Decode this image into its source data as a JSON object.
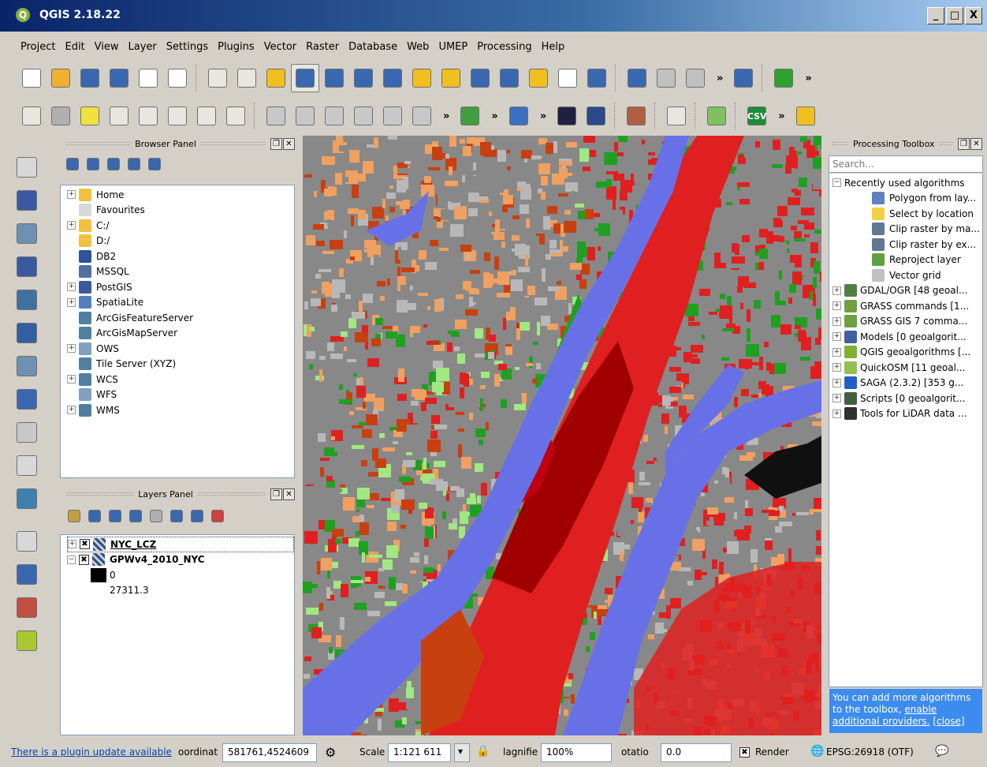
{
  "window": {
    "title": "QGIS 2.18.22",
    "icon": "qgis-logo-icon",
    "min": "_",
    "max": "□",
    "close": "X"
  },
  "menubar": [
    "Project",
    "Edit",
    "View",
    "Layer",
    "Settings",
    "Plugins",
    "Vector",
    "Raster",
    "Database",
    "Web",
    "UMEP",
    "Processing",
    "Help"
  ],
  "toolbar1": [
    {
      "name": "new-project-icon",
      "color": "#ffffff"
    },
    {
      "name": "open-project-icon",
      "color": "#f0b030"
    },
    {
      "name": "save-project-icon",
      "color": "#3a68b0"
    },
    {
      "name": "save-as-icon",
      "color": "#3a68b0"
    },
    {
      "name": "new-print-composer-icon",
      "color": "#ffffff"
    },
    {
      "name": "composer-manager-icon",
      "color": "#ffffff"
    },
    {
      "sep": true
    },
    {
      "name": "touch-zoom-icon",
      "color": "#e8e6e0"
    },
    {
      "name": "pan-icon",
      "color": "#e8e6e0"
    },
    {
      "name": "pan-to-selection-icon",
      "color": "#f0c020"
    },
    {
      "name": "zoom-in-icon",
      "color": "#3a68b0",
      "selected": true
    },
    {
      "name": "zoom-out-icon",
      "color": "#3a68b0"
    },
    {
      "name": "zoom-native-icon",
      "color": "#3a68b0"
    },
    {
      "name": "zoom-full-icon",
      "color": "#3a68b0"
    },
    {
      "name": "zoom-to-selection-icon",
      "color": "#f0c020"
    },
    {
      "name": "zoom-to-layer-icon",
      "color": "#f0c020"
    },
    {
      "name": "zoom-last-icon",
      "color": "#3a68b0"
    },
    {
      "name": "zoom-next-icon",
      "color": "#3a68b0"
    },
    {
      "name": "new-map-view-icon",
      "color": "#f0c020"
    },
    {
      "name": "new-bookmark-icon",
      "color": "#ffffff"
    },
    {
      "name": "refresh-icon",
      "color": "#3a68b0"
    },
    {
      "sep": true
    },
    {
      "name": "identify-icon",
      "color": "#3a68b0"
    },
    {
      "name": "action-icon",
      "color": "#c0c0c0"
    },
    {
      "name": "select-features-icon",
      "color": "#c0c0c0"
    },
    {
      "more": "»"
    },
    {
      "name": "help-icon",
      "color": "#3a68b0"
    },
    {
      "sep": true
    },
    {
      "name": "plugin-green-icon",
      "color": "#30a030"
    },
    {
      "more": "»"
    }
  ],
  "toolbar2": [
    {
      "name": "label-abc-icon",
      "color": "#e8e6e0"
    },
    {
      "name": "label-pin-icon",
      "color": "#b0b0b0"
    },
    {
      "name": "label-highlight-icon",
      "color": "#f0e040"
    },
    {
      "name": "label-move-icon",
      "color": "#e8e6e0"
    },
    {
      "name": "label-show-hide-icon",
      "color": "#e8e6e0"
    },
    {
      "name": "label-rotate-icon",
      "color": "#e8e6e0"
    },
    {
      "name": "label-change-icon",
      "color": "#e8e6e0"
    },
    {
      "name": "label-abc2-icon",
      "color": "#e8e6e0"
    },
    {
      "sep": true
    },
    {
      "name": "edit-pencil-icon",
      "color": "#c8c8c8"
    },
    {
      "name": "toggle-edit-icon",
      "color": "#c8c8c8"
    },
    {
      "name": "save-edits-icon",
      "color": "#c8c8c8"
    },
    {
      "name": "add-feature-icon",
      "color": "#c8c8c8"
    },
    {
      "name": "node-tool-icon",
      "color": "#c8c8c8"
    },
    {
      "name": "delete-selected-icon",
      "color": "#c8c8c8"
    },
    {
      "more": "»"
    },
    {
      "name": "histogram-icon",
      "color": "#40a040"
    },
    {
      "more": "»"
    },
    {
      "name": "python-icon",
      "color": "#3a70c0"
    },
    {
      "more": "»"
    },
    {
      "name": "layer-black-icon",
      "color": "#202040"
    },
    {
      "name": "diamond-icon",
      "color": "#2a4a8a"
    },
    {
      "sep": true
    },
    {
      "name": "terrain-icon",
      "color": "#b06040"
    },
    {
      "sep": true
    },
    {
      "name": "profile-icon",
      "color": "#e8e6e0"
    },
    {
      "sep": true
    },
    {
      "name": "map-grid-icon",
      "color": "#80c060"
    },
    {
      "sep": true
    },
    {
      "name": "csv-icon",
      "color": "#1e8c3a",
      "text": "CSV"
    },
    {
      "more": "»"
    },
    {
      "name": "plug-icon",
      "color": "#f0c020"
    }
  ],
  "browser": {
    "title": "Browser Panel",
    "tools": [
      {
        "name": "add-selected-icon",
        "color": "#3a68b0"
      },
      {
        "name": "refresh-icon",
        "color": "#3a68b0"
      },
      {
        "name": "filter-icon",
        "color": "#3a68b0"
      },
      {
        "name": "collapse-all-icon",
        "color": "#3a68b0"
      },
      {
        "name": "properties-icon",
        "color": "#3a68b0"
      }
    ],
    "items": [
      {
        "label": "Home",
        "icon": "folder-icon",
        "color": "#f0c040",
        "exp": true
      },
      {
        "label": "Favourites",
        "icon": "star-icon",
        "color": "#d8d8d8"
      },
      {
        "label": "C:/",
        "icon": "folder-icon",
        "color": "#f0c040",
        "exp": true
      },
      {
        "label": "D:/",
        "icon": "folder-icon",
        "color": "#f0c040"
      },
      {
        "label": "DB2",
        "icon": "db2-icon",
        "color": "#3050a0"
      },
      {
        "label": "MSSQL",
        "icon": "mssql-icon",
        "color": "#5070a0"
      },
      {
        "label": "PostGIS",
        "icon": "postgis-elephant-icon",
        "color": "#3a5aa0",
        "exp": true
      },
      {
        "label": "SpatiaLite",
        "icon": "spatialite-feather-icon",
        "color": "#5080c0",
        "exp": true
      },
      {
        "label": "ArcGisFeatureServer",
        "icon": "globe-icon",
        "color": "#5080a0"
      },
      {
        "label": "ArcGisMapServer",
        "icon": "globe-icon",
        "color": "#5080a0"
      },
      {
        "label": "OWS",
        "icon": "ows-globe-icon",
        "color": "#80a0c0",
        "exp": true
      },
      {
        "label": "Tile Server (XYZ)",
        "icon": "globe-icon",
        "color": "#5080a0"
      },
      {
        "label": "WCS",
        "icon": "wcs-globe-icon",
        "color": "#5080a0",
        "exp": true
      },
      {
        "label": "WFS",
        "icon": "wfs-globe-icon",
        "color": "#80a0c0"
      },
      {
        "label": "WMS",
        "icon": "wms-globe-icon",
        "color": "#5080a0",
        "exp": true
      }
    ]
  },
  "layers": {
    "title": "Layers Panel",
    "tools": [
      {
        "name": "styling-icon",
        "color": "#c0a040"
      },
      {
        "name": "add-group-icon",
        "color": "#3a68b0"
      },
      {
        "name": "visibility-icon",
        "color": "#3a68b0"
      },
      {
        "name": "filter-legend-icon",
        "color": "#3a68b0"
      },
      {
        "name": "filter-expression-icon",
        "color": "#b0b0b0"
      },
      {
        "name": "expand-all-icon",
        "color": "#3a68b0"
      },
      {
        "name": "collapse-all-icon",
        "color": "#3a68b0"
      },
      {
        "name": "remove-layer-icon",
        "color": "#d04040"
      }
    ],
    "items": [
      {
        "label": "NYC_LCZ",
        "checked": "✖",
        "exp": "+"
      },
      {
        "label": "GPWv4_2010_NYC",
        "checked": "✖",
        "exp": "−"
      }
    ],
    "legend": [
      "0",
      "27311.3"
    ]
  },
  "processing": {
    "title": "Processing Toolbox",
    "search_placeholder": "Search...",
    "recent": "Recently used algorithms",
    "recent_items": [
      {
        "label": "Polygon from lay...",
        "icon": "polygon-icon",
        "color": "#6080c0"
      },
      {
        "label": "Select by location",
        "icon": "select-location-icon",
        "color": "#f0d040"
      },
      {
        "label": "Clip raster by ma...",
        "icon": "raster-icon",
        "color": "#607890"
      },
      {
        "label": "Clip raster by ex...",
        "icon": "raster-icon",
        "color": "#607890"
      },
      {
        "label": "Reproject layer",
        "icon": "reproject-icon",
        "color": "#60a040"
      },
      {
        "label": "Vector grid",
        "icon": "grid-icon",
        "color": "#c0c0c0"
      }
    ],
    "providers": [
      {
        "label": "GDAL/OGR [48 geoal...",
        "icon": "gdal-icon",
        "color": "#508040"
      },
      {
        "label": "GRASS commands [1...",
        "icon": "grass-icon",
        "color": "#70a040"
      },
      {
        "label": "GRASS GIS 7 comma...",
        "icon": "grass-icon",
        "color": "#70a040"
      },
      {
        "label": "Models [0 geoalgorit...",
        "icon": "models-icon",
        "color": "#4060a0"
      },
      {
        "label": "QGIS geoalgorithms [...",
        "icon": "qgis-algo-icon",
        "color": "#80b030"
      },
      {
        "label": "QuickOSM [11 geoal...",
        "icon": "quickosm-icon",
        "color": "#90c050"
      },
      {
        "label": "SAGA (2.3.2) [353 g...",
        "icon": "saga-icon",
        "color": "#2060c0"
      },
      {
        "label": "Scripts [0 geoalgorit...",
        "icon": "scripts-icon",
        "color": "#406040"
      },
      {
        "label": "Tools for LiDAR data ...",
        "icon": "lidar-icon",
        "color": "#303030"
      }
    ],
    "info_text": "You can add more algorithms to the toolbox, ",
    "info_link": "enable additional providers.",
    "info_close": "[close]"
  },
  "left_tools": [
    {
      "name": "add-vector-layer-icon",
      "color": "#d8d8d8"
    },
    {
      "name": "add-raster-layer-icon",
      "color": "#3a5aa0"
    },
    {
      "name": "add-spatialite-layer-icon",
      "color": "#7090b0"
    },
    {
      "name": "add-postgis-layer-icon",
      "color": "#3a5aa0"
    },
    {
      "name": "add-wms-layer-icon",
      "color": "#4070a0"
    },
    {
      "name": "add-wcs-layer-icon",
      "color": "#3060a0"
    },
    {
      "name": "add-wfs-layer-icon",
      "color": "#7090b0"
    },
    {
      "name": "new-shapefile-icon",
      "color": "#3a68b0"
    },
    {
      "name": "add-delimited-text-icon",
      "color": "#c8c8c8"
    },
    {
      "name": "new-scratch-layer-icon",
      "color": "#d8d8d8"
    },
    {
      "name": "new-gpx-layer-icon",
      "color": "#4080b0"
    },
    {
      "name": "touch-digitize-icon",
      "color": "#d8d8d8"
    },
    {
      "name": "offline-editing-icon",
      "color": "#3a68b0"
    },
    {
      "name": "virtual-layer-icon",
      "color": "#c05040"
    },
    {
      "name": "arrow-cursor-icon",
      "color": "#a8c830"
    }
  ],
  "map": {
    "colors": {
      "water": "#6870e8",
      "urban_dark": "#a00000",
      "urban_red": "#e02020",
      "urban_mid": "#c84010",
      "orange": "#f0a060",
      "grey": "#888888",
      "light_grey": "#b8b8b8",
      "green": "#20a020",
      "light_green": "#a0e880",
      "black": "#101010"
    }
  },
  "status": {
    "plugin_update": "There is a plugin update available",
    "coord_label": "oordinat",
    "coord_value": "581761,4524609",
    "scale_label": "Scale",
    "scale_value": "1:121 611",
    "magnifier_label": "lagnifie",
    "magnifier_value": "100%",
    "rotation_label": "otatio",
    "rotation_value": "0.0",
    "render_check": "✖",
    "render_label": "Render",
    "crs": "EPSG:26918 (OTF)"
  }
}
